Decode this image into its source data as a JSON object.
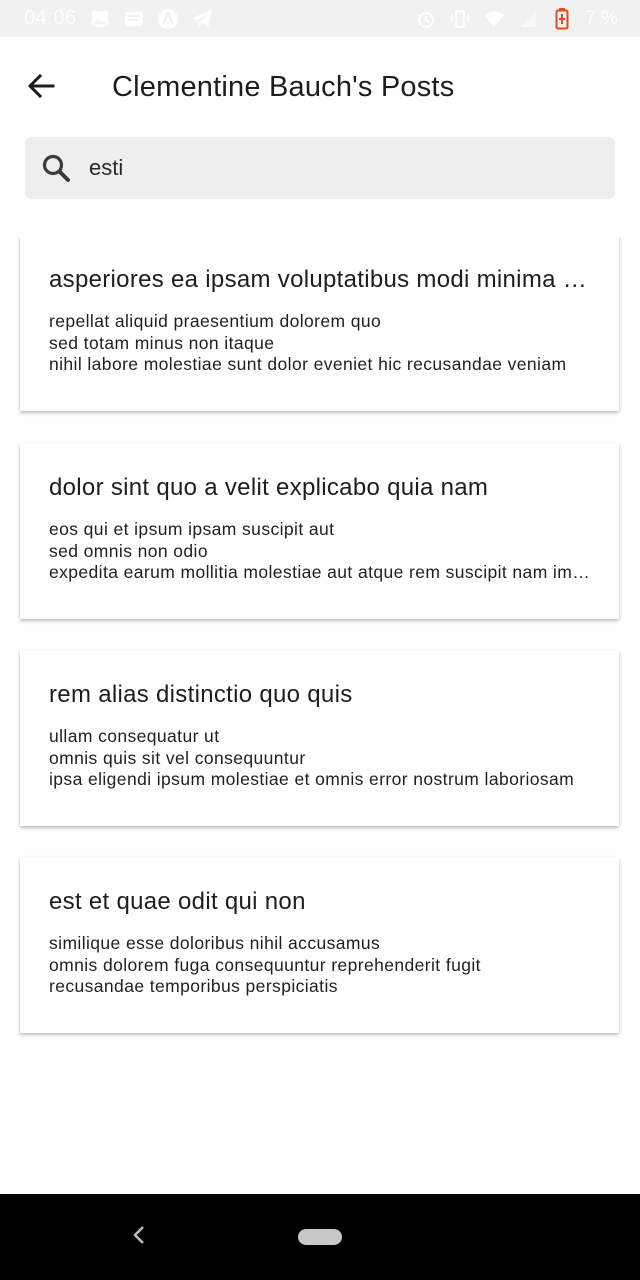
{
  "status_bar": {
    "time": "04:06",
    "battery_percent": "7 %",
    "left_icons": [
      "image-icon",
      "news-icon",
      "app-logo-icon",
      "telegram-icon"
    ],
    "right_icons": [
      "alarm-icon",
      "vibrate-icon",
      "wifi-icon",
      "signal-icon",
      "battery-low-icon"
    ]
  },
  "app_bar": {
    "title": "Clementine Bauch's Posts",
    "back_icon": "arrow-back-icon"
  },
  "search": {
    "value": "esti",
    "icon": "search-icon"
  },
  "posts": [
    {
      "title": "asperiores ea ipsam voluptatibus modi minima ia fugit",
      "body_lines": [
        "repellat aliquid praesentium dolorem quo",
        "sed totam minus non itaque",
        "nihil labore molestiae sunt dolor eveniet hic recusandae veniam"
      ]
    },
    {
      "title": "dolor sint quo a velit explicabo quia nam",
      "body_lines": [
        "eos qui et ipsum ipsam suscipit aut",
        "sed omnis non odio",
        "expedita earum mollitia molestiae aut atque rem suscipit nam impedit"
      ]
    },
    {
      "title": "rem alias distinctio quo quis",
      "body_lines": [
        "ullam consequatur ut",
        "omnis quis sit vel consequuntur",
        "ipsa eligendi ipsum molestiae et omnis error nostrum laboriosam"
      ]
    },
    {
      "title": "est et quae odit qui non",
      "body_lines": [
        "similique esse doloribus nihil accusamus",
        "omnis dolorem fuga consequuntur reprehenderit fugit",
        "recusandae temporibus perspiciatis"
      ]
    }
  ],
  "nav_bar": {
    "back_icon": "nav-back-icon",
    "home_icon": "nav-home-pill-icon"
  },
  "colors": {
    "status_bar_bg": "#f1f1f1",
    "battery_low": "#e64a19",
    "search_bg": "#eeeeee",
    "nav_bar_bg": "#000000"
  }
}
